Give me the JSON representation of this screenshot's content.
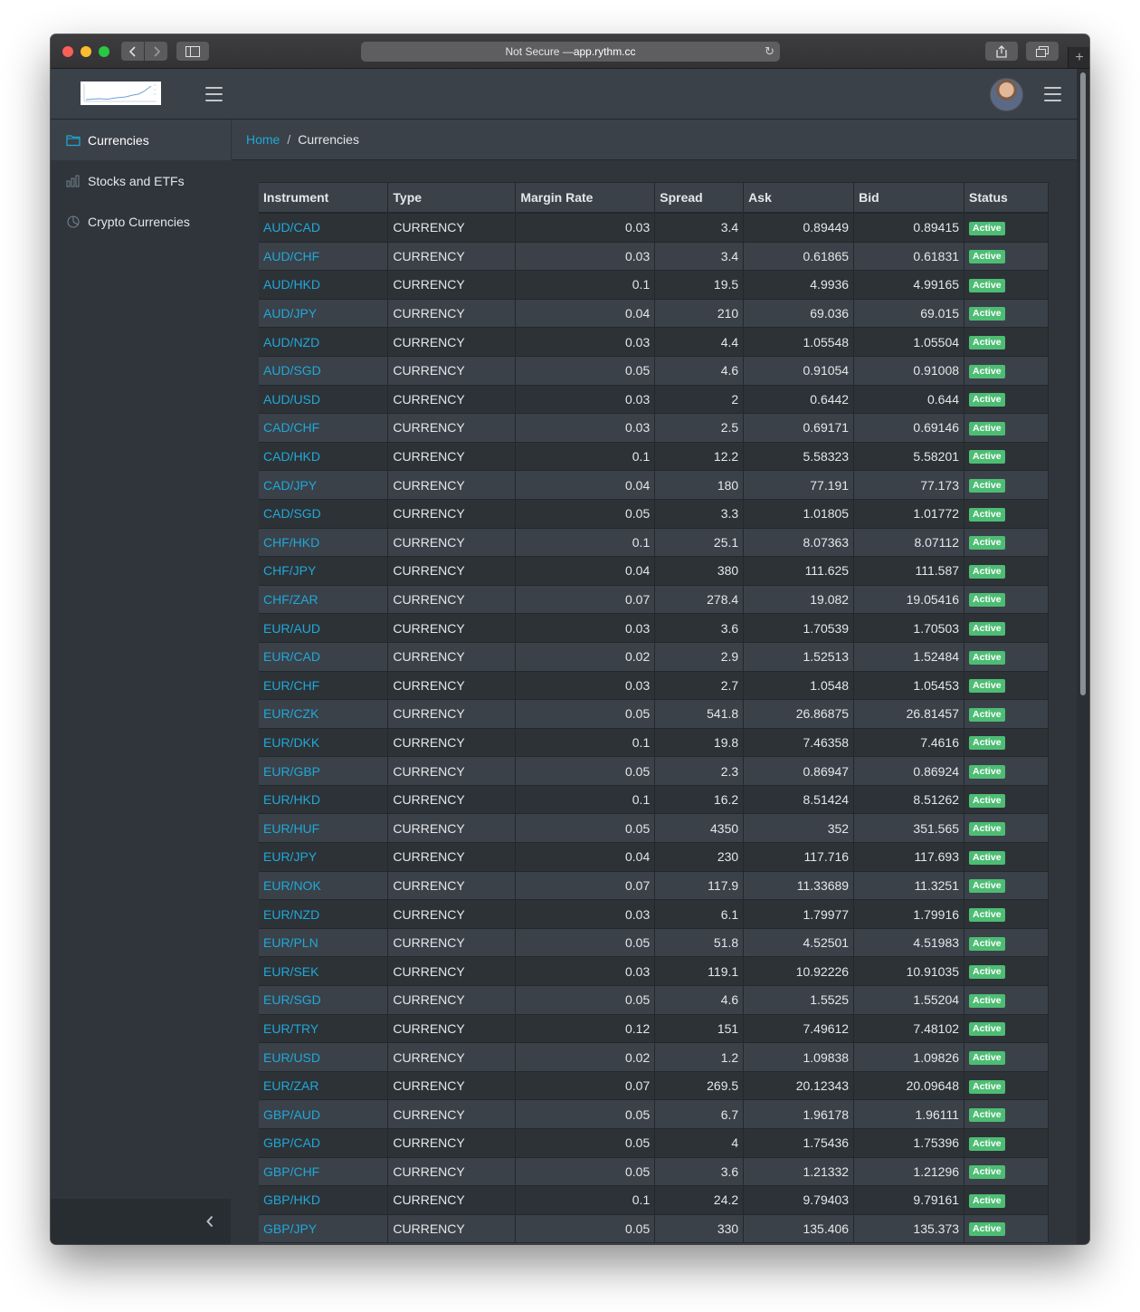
{
  "browser": {
    "address_prefix": "Not Secure — ",
    "address_host": "app.rythm.cc"
  },
  "sidebar": {
    "items": [
      {
        "label": "Currencies",
        "icon": "folder-icon"
      },
      {
        "label": "Stocks and ETFs",
        "icon": "bar-chart-icon"
      },
      {
        "label": "Crypto Currencies",
        "icon": "pie-chart-icon"
      }
    ]
  },
  "breadcrumb": {
    "home": "Home",
    "separator": "/",
    "current": "Currencies"
  },
  "table": {
    "headers": [
      "Instrument",
      "Type",
      "Margin Rate",
      "Spread",
      "Ask",
      "Bid",
      "Status"
    ],
    "rows": [
      [
        "AUD/CAD",
        "CURRENCY",
        "0.03",
        "3.4",
        "0.89449",
        "0.89415",
        "Active"
      ],
      [
        "AUD/CHF",
        "CURRENCY",
        "0.03",
        "3.4",
        "0.61865",
        "0.61831",
        "Active"
      ],
      [
        "AUD/HKD",
        "CURRENCY",
        "0.1",
        "19.5",
        "4.9936",
        "4.99165",
        "Active"
      ],
      [
        "AUD/JPY",
        "CURRENCY",
        "0.04",
        "210",
        "69.036",
        "69.015",
        "Active"
      ],
      [
        "AUD/NZD",
        "CURRENCY",
        "0.03",
        "4.4",
        "1.05548",
        "1.05504",
        "Active"
      ],
      [
        "AUD/SGD",
        "CURRENCY",
        "0.05",
        "4.6",
        "0.91054",
        "0.91008",
        "Active"
      ],
      [
        "AUD/USD",
        "CURRENCY",
        "0.03",
        "2",
        "0.6442",
        "0.644",
        "Active"
      ],
      [
        "CAD/CHF",
        "CURRENCY",
        "0.03",
        "2.5",
        "0.69171",
        "0.69146",
        "Active"
      ],
      [
        "CAD/HKD",
        "CURRENCY",
        "0.1",
        "12.2",
        "5.58323",
        "5.58201",
        "Active"
      ],
      [
        "CAD/JPY",
        "CURRENCY",
        "0.04",
        "180",
        "77.191",
        "77.173",
        "Active"
      ],
      [
        "CAD/SGD",
        "CURRENCY",
        "0.05",
        "3.3",
        "1.01805",
        "1.01772",
        "Active"
      ],
      [
        "CHF/HKD",
        "CURRENCY",
        "0.1",
        "25.1",
        "8.07363",
        "8.07112",
        "Active"
      ],
      [
        "CHF/JPY",
        "CURRENCY",
        "0.04",
        "380",
        "111.625",
        "111.587",
        "Active"
      ],
      [
        "CHF/ZAR",
        "CURRENCY",
        "0.07",
        "278.4",
        "19.082",
        "19.05416",
        "Active"
      ],
      [
        "EUR/AUD",
        "CURRENCY",
        "0.03",
        "3.6",
        "1.70539",
        "1.70503",
        "Active"
      ],
      [
        "EUR/CAD",
        "CURRENCY",
        "0.02",
        "2.9",
        "1.52513",
        "1.52484",
        "Active"
      ],
      [
        "EUR/CHF",
        "CURRENCY",
        "0.03",
        "2.7",
        "1.0548",
        "1.05453",
        "Active"
      ],
      [
        "EUR/CZK",
        "CURRENCY",
        "0.05",
        "541.8",
        "26.86875",
        "26.81457",
        "Active"
      ],
      [
        "EUR/DKK",
        "CURRENCY",
        "0.1",
        "19.8",
        "7.46358",
        "7.4616",
        "Active"
      ],
      [
        "EUR/GBP",
        "CURRENCY",
        "0.05",
        "2.3",
        "0.86947",
        "0.86924",
        "Active"
      ],
      [
        "EUR/HKD",
        "CURRENCY",
        "0.1",
        "16.2",
        "8.51424",
        "8.51262",
        "Active"
      ],
      [
        "EUR/HUF",
        "CURRENCY",
        "0.05",
        "4350",
        "352",
        "351.565",
        "Active"
      ],
      [
        "EUR/JPY",
        "CURRENCY",
        "0.04",
        "230",
        "117.716",
        "117.693",
        "Active"
      ],
      [
        "EUR/NOK",
        "CURRENCY",
        "0.07",
        "117.9",
        "11.33689",
        "11.3251",
        "Active"
      ],
      [
        "EUR/NZD",
        "CURRENCY",
        "0.03",
        "6.1",
        "1.79977",
        "1.79916",
        "Active"
      ],
      [
        "EUR/PLN",
        "CURRENCY",
        "0.05",
        "51.8",
        "4.52501",
        "4.51983",
        "Active"
      ],
      [
        "EUR/SEK",
        "CURRENCY",
        "0.03",
        "119.1",
        "10.92226",
        "10.91035",
        "Active"
      ],
      [
        "EUR/SGD",
        "CURRENCY",
        "0.05",
        "4.6",
        "1.5525",
        "1.55204",
        "Active"
      ],
      [
        "EUR/TRY",
        "CURRENCY",
        "0.12",
        "151",
        "7.49612",
        "7.48102",
        "Active"
      ],
      [
        "EUR/USD",
        "CURRENCY",
        "0.02",
        "1.2",
        "1.09838",
        "1.09826",
        "Active"
      ],
      [
        "EUR/ZAR",
        "CURRENCY",
        "0.07",
        "269.5",
        "20.12343",
        "20.09648",
        "Active"
      ],
      [
        "GBP/AUD",
        "CURRENCY",
        "0.05",
        "6.7",
        "1.96178",
        "1.96111",
        "Active"
      ],
      [
        "GBP/CAD",
        "CURRENCY",
        "0.05",
        "4",
        "1.75436",
        "1.75396",
        "Active"
      ],
      [
        "GBP/CHF",
        "CURRENCY",
        "0.05",
        "3.6",
        "1.21332",
        "1.21296",
        "Active"
      ],
      [
        "GBP/HKD",
        "CURRENCY",
        "0.1",
        "24.2",
        "9.79403",
        "9.79161",
        "Active"
      ],
      [
        "GBP/JPY",
        "CURRENCY",
        "0.05",
        "330",
        "135.406",
        "135.373",
        "Active"
      ]
    ]
  },
  "colors": {
    "accent": "#20a8d8",
    "badge_success": "#4dbd74",
    "header_bg": "#3a4149",
    "sidebar_bg": "#2f353a"
  }
}
